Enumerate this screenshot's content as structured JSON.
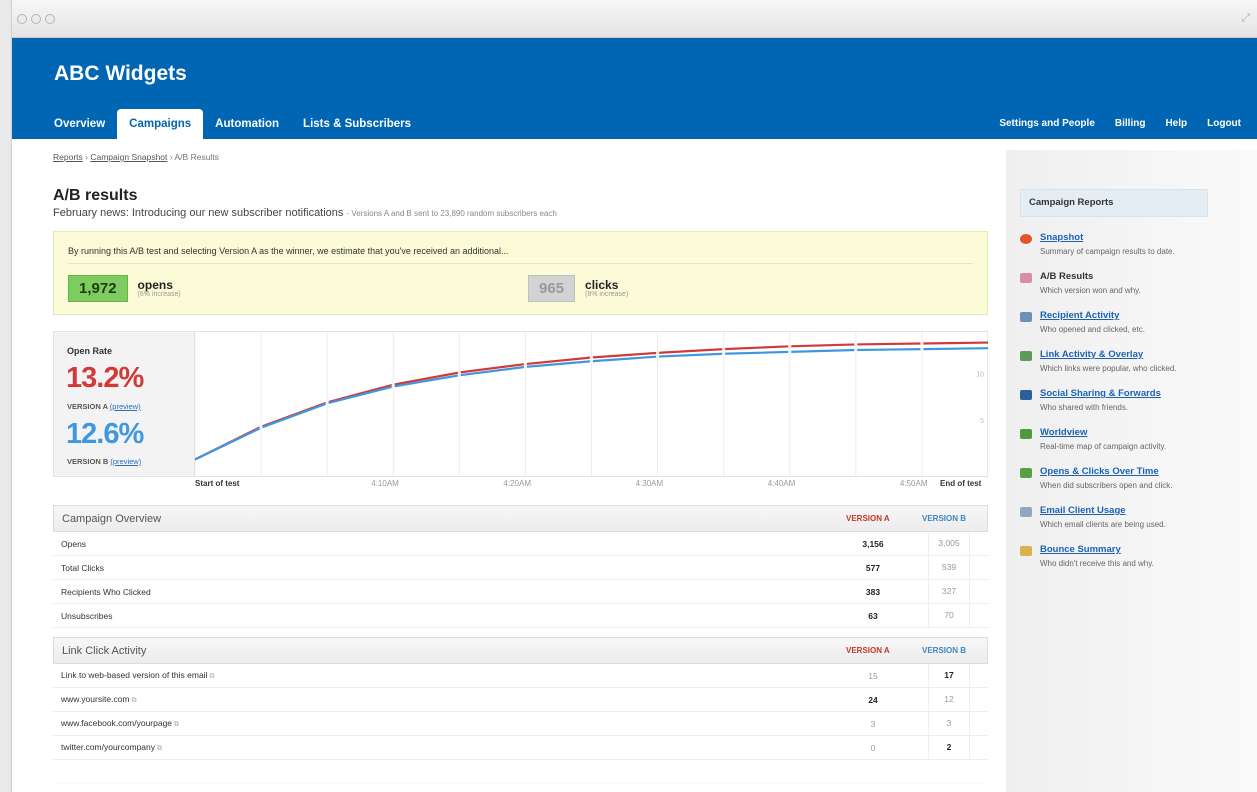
{
  "window": {
    "titlebar_dots": "○○○"
  },
  "header": {
    "brand": "ABC Widgets",
    "tabs": [
      {
        "label": "Overview"
      },
      {
        "label": "Campaigns"
      },
      {
        "label": "Automation"
      },
      {
        "label": "Lists & Subscribers"
      }
    ],
    "right_links": [
      {
        "label": "Settings and People"
      },
      {
        "label": "Billing"
      },
      {
        "label": "Help"
      },
      {
        "label": "Logout"
      }
    ]
  },
  "breadcrumb": {
    "item1": "Reports",
    "item2": "Campaign Snapshot",
    "current": "A/B Results",
    "sep": "›"
  },
  "page": {
    "title": "A/B results",
    "subtitle": "February news: Introducing our new subscriber notifications",
    "subtitle_note": "- Versions A and B sent to 23,890 random subscribers each"
  },
  "callout": {
    "lead": "By running this A/B test and selecting Version A as the winner, we estimate that you've received an additional...",
    "opens": {
      "value": "1,972",
      "label": "opens",
      "sub": "(6% increase)"
    },
    "clicks": {
      "value": "965",
      "label": "clicks",
      "sub": "(8% increase)"
    }
  },
  "open_rate": {
    "title": "Open Rate",
    "a_value": "13.2%",
    "a_label": "VERSION A",
    "b_value": "12.6%",
    "b_label": "VERSION B",
    "preview": "(preview)"
  },
  "colors": {
    "version_a": "#d03a3a",
    "version_b": "#3f98df",
    "brand": "#0066b3"
  },
  "chart_data": {
    "type": "line",
    "x": [
      "Start of test",
      "",
      "",
      "4:10AM",
      "",
      "4:20AM",
      "",
      "4:30AM",
      "",
      "4:40AM",
      "",
      "4:50AM",
      "End of test"
    ],
    "series": [
      {
        "values": [
          0.8,
          4.3,
          6.9,
          8.8,
          10.1,
          11.0,
          11.7,
          12.2,
          12.6,
          12.9,
          13.1,
          13.2,
          13.3
        ]
      },
      {
        "values": [
          0.8,
          4.2,
          6.8,
          8.6,
          9.8,
          10.7,
          11.3,
          11.8,
          12.1,
          12.3,
          12.5,
          12.6,
          12.7
        ]
      }
    ],
    "ylim": [
      0,
      14
    ],
    "y_tick_labels": [
      "10",
      "5"
    ],
    "x_axis_labels": [
      "Start of test",
      "4:10AM",
      "4:20AM",
      "4:30AM",
      "4:40AM",
      "4:50AM",
      "End of test"
    ],
    "grid": true
  },
  "overview": {
    "title": "Campaign Overview",
    "col_a": "VERSION A",
    "col_b": "VERSION B",
    "rows": [
      {
        "label": "Opens",
        "a": "3,156",
        "b": "3,005"
      },
      {
        "label": "Total Clicks",
        "a": "577",
        "b": "539"
      },
      {
        "label": "Recipients Who Clicked",
        "a": "383",
        "b": "327"
      },
      {
        "label": "Unsubscribes",
        "a": "63",
        "b": "70"
      }
    ]
  },
  "links": {
    "title": "Link Click Activity",
    "col_a": "VERSION A",
    "col_b": "VERSION B",
    "rows": [
      {
        "label": "Link to web-based version of this email",
        "a": "15",
        "b": "17"
      },
      {
        "label": "www.yoursite.com",
        "a": "24",
        "b": "12"
      },
      {
        "label": "www.facebook.com/yourpage",
        "a": "3",
        "b": "3"
      },
      {
        "label": "twitter.com/yourcompany",
        "a": "0",
        "b": "2"
      }
    ]
  },
  "sidebar": {
    "title": "Campaign Reports",
    "items": [
      {
        "title": "Snapshot",
        "desc": "Summary of campaign results to date.",
        "icon": "pie-chart-icon",
        "color": "#e2542a"
      },
      {
        "title": "A/B Results",
        "desc": "Which version won and why.",
        "icon": "ab-split-icon",
        "color": "#d98ea4"
      },
      {
        "title": "Recipient Activity",
        "desc": "Who opened and clicked, etc.",
        "icon": "recipient-card-icon",
        "color": "#6d8fb8"
      },
      {
        "title": "Link Activity & Overlay",
        "desc": "Which links were popular, who clicked.",
        "icon": "link-icon",
        "color": "#5c9a55"
      },
      {
        "title": "Social Sharing & Forwards",
        "desc": "Who shared with friends.",
        "icon": "share-icon",
        "color": "#2d5f9e"
      },
      {
        "title": "Worldview",
        "desc": "Real-time map of campaign activity.",
        "icon": "map-pin-icon",
        "color": "#4f9b3a"
      },
      {
        "title": "Opens & Clicks Over Time",
        "desc": "When did subscribers open and click.",
        "icon": "line-chart-icon",
        "color": "#56a045"
      },
      {
        "title": "Email Client Usage",
        "desc": "Which email clients are being used.",
        "icon": "email-client-icon",
        "color": "#8fa7bf"
      },
      {
        "title": "Bounce Summary",
        "desc": "Who didn't receive this and why.",
        "icon": "bounce-icon",
        "color": "#d9b24c"
      }
    ]
  }
}
